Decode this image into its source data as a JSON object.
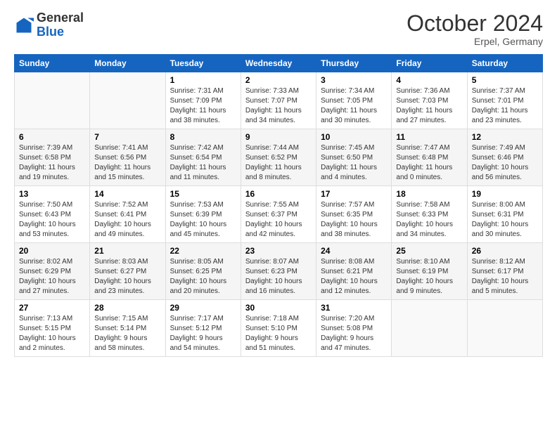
{
  "header": {
    "logo_general": "General",
    "logo_blue": "Blue",
    "month_title": "October 2024",
    "subtitle": "Erpel, Germany"
  },
  "days_of_week": [
    "Sunday",
    "Monday",
    "Tuesday",
    "Wednesday",
    "Thursday",
    "Friday",
    "Saturday"
  ],
  "weeks": [
    [
      {
        "day": "",
        "info": ""
      },
      {
        "day": "",
        "info": ""
      },
      {
        "day": "1",
        "info": "Sunrise: 7:31 AM\nSunset: 7:09 PM\nDaylight: 11 hours and 38 minutes."
      },
      {
        "day": "2",
        "info": "Sunrise: 7:33 AM\nSunset: 7:07 PM\nDaylight: 11 hours and 34 minutes."
      },
      {
        "day": "3",
        "info": "Sunrise: 7:34 AM\nSunset: 7:05 PM\nDaylight: 11 hours and 30 minutes."
      },
      {
        "day": "4",
        "info": "Sunrise: 7:36 AM\nSunset: 7:03 PM\nDaylight: 11 hours and 27 minutes."
      },
      {
        "day": "5",
        "info": "Sunrise: 7:37 AM\nSunset: 7:01 PM\nDaylight: 11 hours and 23 minutes."
      }
    ],
    [
      {
        "day": "6",
        "info": "Sunrise: 7:39 AM\nSunset: 6:58 PM\nDaylight: 11 hours and 19 minutes."
      },
      {
        "day": "7",
        "info": "Sunrise: 7:41 AM\nSunset: 6:56 PM\nDaylight: 11 hours and 15 minutes."
      },
      {
        "day": "8",
        "info": "Sunrise: 7:42 AM\nSunset: 6:54 PM\nDaylight: 11 hours and 11 minutes."
      },
      {
        "day": "9",
        "info": "Sunrise: 7:44 AM\nSunset: 6:52 PM\nDaylight: 11 hours and 8 minutes."
      },
      {
        "day": "10",
        "info": "Sunrise: 7:45 AM\nSunset: 6:50 PM\nDaylight: 11 hours and 4 minutes."
      },
      {
        "day": "11",
        "info": "Sunrise: 7:47 AM\nSunset: 6:48 PM\nDaylight: 11 hours and 0 minutes."
      },
      {
        "day": "12",
        "info": "Sunrise: 7:49 AM\nSunset: 6:46 PM\nDaylight: 10 hours and 56 minutes."
      }
    ],
    [
      {
        "day": "13",
        "info": "Sunrise: 7:50 AM\nSunset: 6:43 PM\nDaylight: 10 hours and 53 minutes."
      },
      {
        "day": "14",
        "info": "Sunrise: 7:52 AM\nSunset: 6:41 PM\nDaylight: 10 hours and 49 minutes."
      },
      {
        "day": "15",
        "info": "Sunrise: 7:53 AM\nSunset: 6:39 PM\nDaylight: 10 hours and 45 minutes."
      },
      {
        "day": "16",
        "info": "Sunrise: 7:55 AM\nSunset: 6:37 PM\nDaylight: 10 hours and 42 minutes."
      },
      {
        "day": "17",
        "info": "Sunrise: 7:57 AM\nSunset: 6:35 PM\nDaylight: 10 hours and 38 minutes."
      },
      {
        "day": "18",
        "info": "Sunrise: 7:58 AM\nSunset: 6:33 PM\nDaylight: 10 hours and 34 minutes."
      },
      {
        "day": "19",
        "info": "Sunrise: 8:00 AM\nSunset: 6:31 PM\nDaylight: 10 hours and 30 minutes."
      }
    ],
    [
      {
        "day": "20",
        "info": "Sunrise: 8:02 AM\nSunset: 6:29 PM\nDaylight: 10 hours and 27 minutes."
      },
      {
        "day": "21",
        "info": "Sunrise: 8:03 AM\nSunset: 6:27 PM\nDaylight: 10 hours and 23 minutes."
      },
      {
        "day": "22",
        "info": "Sunrise: 8:05 AM\nSunset: 6:25 PM\nDaylight: 10 hours and 20 minutes."
      },
      {
        "day": "23",
        "info": "Sunrise: 8:07 AM\nSunset: 6:23 PM\nDaylight: 10 hours and 16 minutes."
      },
      {
        "day": "24",
        "info": "Sunrise: 8:08 AM\nSunset: 6:21 PM\nDaylight: 10 hours and 12 minutes."
      },
      {
        "day": "25",
        "info": "Sunrise: 8:10 AM\nSunset: 6:19 PM\nDaylight: 10 hours and 9 minutes."
      },
      {
        "day": "26",
        "info": "Sunrise: 8:12 AM\nSunset: 6:17 PM\nDaylight: 10 hours and 5 minutes."
      }
    ],
    [
      {
        "day": "27",
        "info": "Sunrise: 7:13 AM\nSunset: 5:15 PM\nDaylight: 10 hours and 2 minutes."
      },
      {
        "day": "28",
        "info": "Sunrise: 7:15 AM\nSunset: 5:14 PM\nDaylight: 9 hours and 58 minutes."
      },
      {
        "day": "29",
        "info": "Sunrise: 7:17 AM\nSunset: 5:12 PM\nDaylight: 9 hours and 54 minutes."
      },
      {
        "day": "30",
        "info": "Sunrise: 7:18 AM\nSunset: 5:10 PM\nDaylight: 9 hours and 51 minutes."
      },
      {
        "day": "31",
        "info": "Sunrise: 7:20 AM\nSunset: 5:08 PM\nDaylight: 9 hours and 47 minutes."
      },
      {
        "day": "",
        "info": ""
      },
      {
        "day": "",
        "info": ""
      }
    ]
  ]
}
